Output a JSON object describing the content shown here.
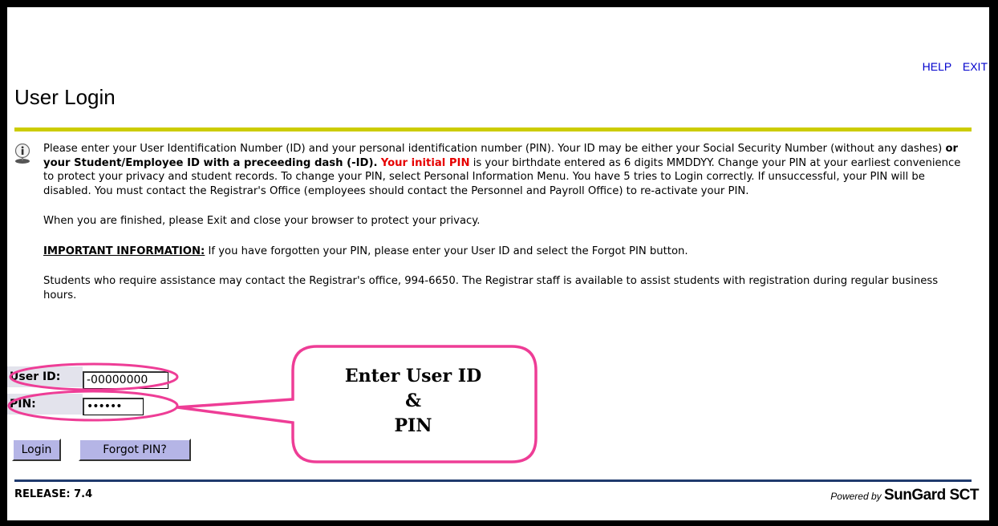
{
  "header": {
    "links": [
      "HELP",
      "EXIT"
    ],
    "title": "User Login"
  },
  "info": {
    "p1": {
      "a": "Please enter your User Identification Number (ID) and your personal identification number (PIN). Your ID may be either your Social Security Number (without any dashes) ",
      "b": "or your Student/Employee ID with a preceeding dash (-ID).",
      "c": "Your initial PIN",
      "d": " is your birthdate entered as 6 digits MMDDYY. Change your PIN at your earliest convenience to protect your privacy and student records. To change your PIN, select Personal Information Menu. You have 5 tries to Login correctly. If unsuccessful, your PIN will be disabled. You must contact the Registrar's Office (employees should contact the Personnel and Payroll Office) to re-activate your PIN."
    },
    "p2": "When you are finished, please Exit and close your browser to protect your privacy.",
    "p3": {
      "label": "IMPORTANT INFORMATION:",
      "text": " If you have forgotten your PIN, please enter your User ID and select the Forgot PIN button."
    },
    "p4": "Students who require assistance may contact the Registrar's office, 994-6650. The Registrar staff is available to assist students with registration during regular business hours."
  },
  "form": {
    "user_id_label": "User ID:",
    "user_id_value": "-00000000",
    "pin_label": "PIN:",
    "pin_value": "••••••",
    "login_button": "Login",
    "forgot_button": "Forgot PIN?"
  },
  "callout": {
    "line1": "Enter User ID",
    "line2": "&",
    "line3": "PIN"
  },
  "footer": {
    "release": "RELEASE: 7.4",
    "powered_by": "Powered by",
    "brand": "SunGard SCT"
  },
  "colors": {
    "accent_rule": "#cccc00",
    "link": "#0000cc",
    "highlight_red": "#e60000",
    "button_bg": "#b5b5e6",
    "footer_rule": "#1f3a6d",
    "annotation_pink": "#ee3d96"
  },
  "icons": {
    "info": "info-icon"
  }
}
